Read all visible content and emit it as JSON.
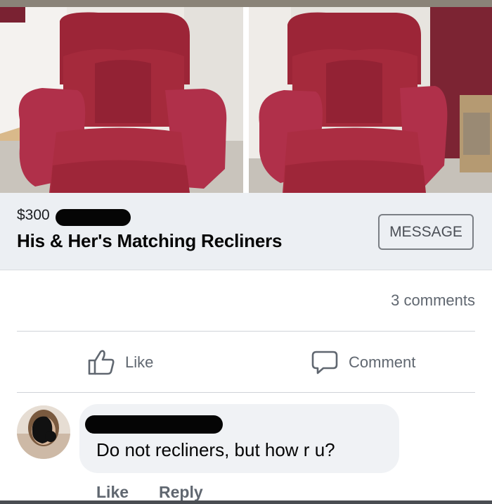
{
  "listing": {
    "price": "$300",
    "title": "His & Her's Matching Recliners",
    "message_label": "MESSAGE"
  },
  "stats": {
    "comments_count": "3 comments"
  },
  "actions": {
    "like_label": "Like",
    "comment_label": "Comment"
  },
  "comment": {
    "text": "Do not recliners,  but how r u?",
    "like_label": "Like",
    "reply_label": "Reply"
  },
  "colors": {
    "chair": "#a52a3c",
    "wall_left": "#f1efec",
    "wall_right": "#7c2433",
    "listing_bar": "#eceff3",
    "bubble": "#f0f2f5"
  },
  "icons": {
    "like": "thumbs-up-icon",
    "comment": "speech-bubble-icon"
  }
}
